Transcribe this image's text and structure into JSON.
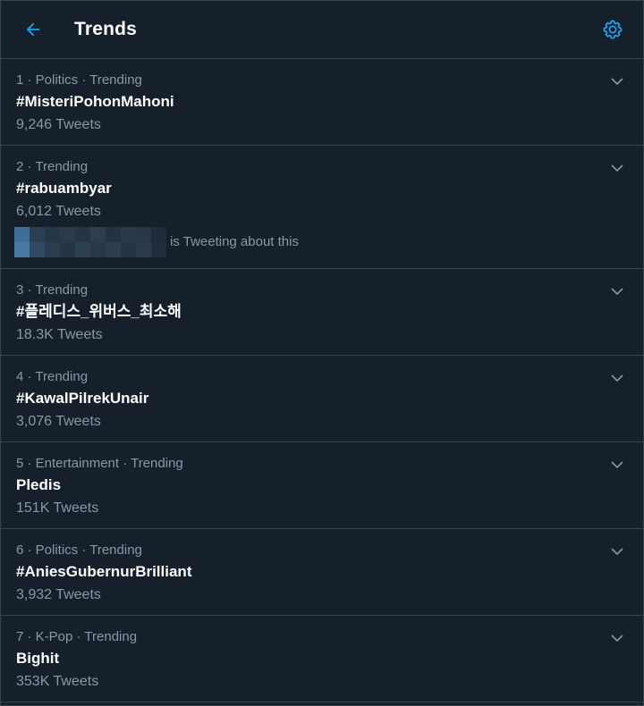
{
  "header": {
    "title": "Trends",
    "back_icon": "arrow-left-icon",
    "settings_icon": "gear-icon"
  },
  "colors": {
    "background": "#15202b",
    "border": "#38444d",
    "accent": "#1da1f2",
    "secondary_text": "#8899a6",
    "primary_text": "#ffffff"
  },
  "trends": [
    {
      "meta": "1 · Politics · Trending",
      "name": "#MisteriPohonMahoni",
      "count": "9,246 Tweets"
    },
    {
      "meta": "2 · Trending",
      "name": "#rabuambyar",
      "count": "6,012 Tweets",
      "extra": "is Tweeting about this"
    },
    {
      "meta": "3 · Trending",
      "name": "#플레디스_위버스_최소해",
      "count": "18.3K Tweets"
    },
    {
      "meta": "4 · Trending",
      "name": "#KawalPilrekUnair",
      "count": "3,076 Tweets"
    },
    {
      "meta": "5 · Entertainment · Trending",
      "name": "Pledis",
      "count": "151K Tweets"
    },
    {
      "meta": "6 · Politics · Trending",
      "name": "#AniesGubernurBrilliant",
      "count": "3,932 Tweets"
    },
    {
      "meta": "7 · K-Pop · Trending",
      "name": "Bighit",
      "count": "353K Tweets"
    }
  ]
}
